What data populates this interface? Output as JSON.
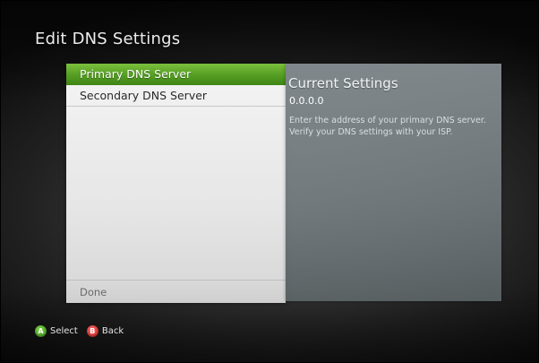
{
  "page": {
    "title": "Edit DNS Settings"
  },
  "menu": {
    "items": [
      {
        "label": "Primary DNS Server",
        "selected": true
      },
      {
        "label": "Secondary DNS Server",
        "selected": false
      }
    ],
    "done_label": "Done"
  },
  "info": {
    "title": "Current Settings",
    "value": "0.0.0.0",
    "description": "Enter the address of your primary DNS server. Verify your DNS settings with your ISP."
  },
  "hints": {
    "a_glyph": "A",
    "a_label": "Select",
    "b_glyph": "B",
    "b_label": "Back"
  },
  "colors": {
    "selected_green": "#57a025",
    "button_a": "#3e8f1c",
    "button_b": "#c01c1c"
  },
  "icons": [
    "a-button-icon",
    "b-button-icon"
  ]
}
